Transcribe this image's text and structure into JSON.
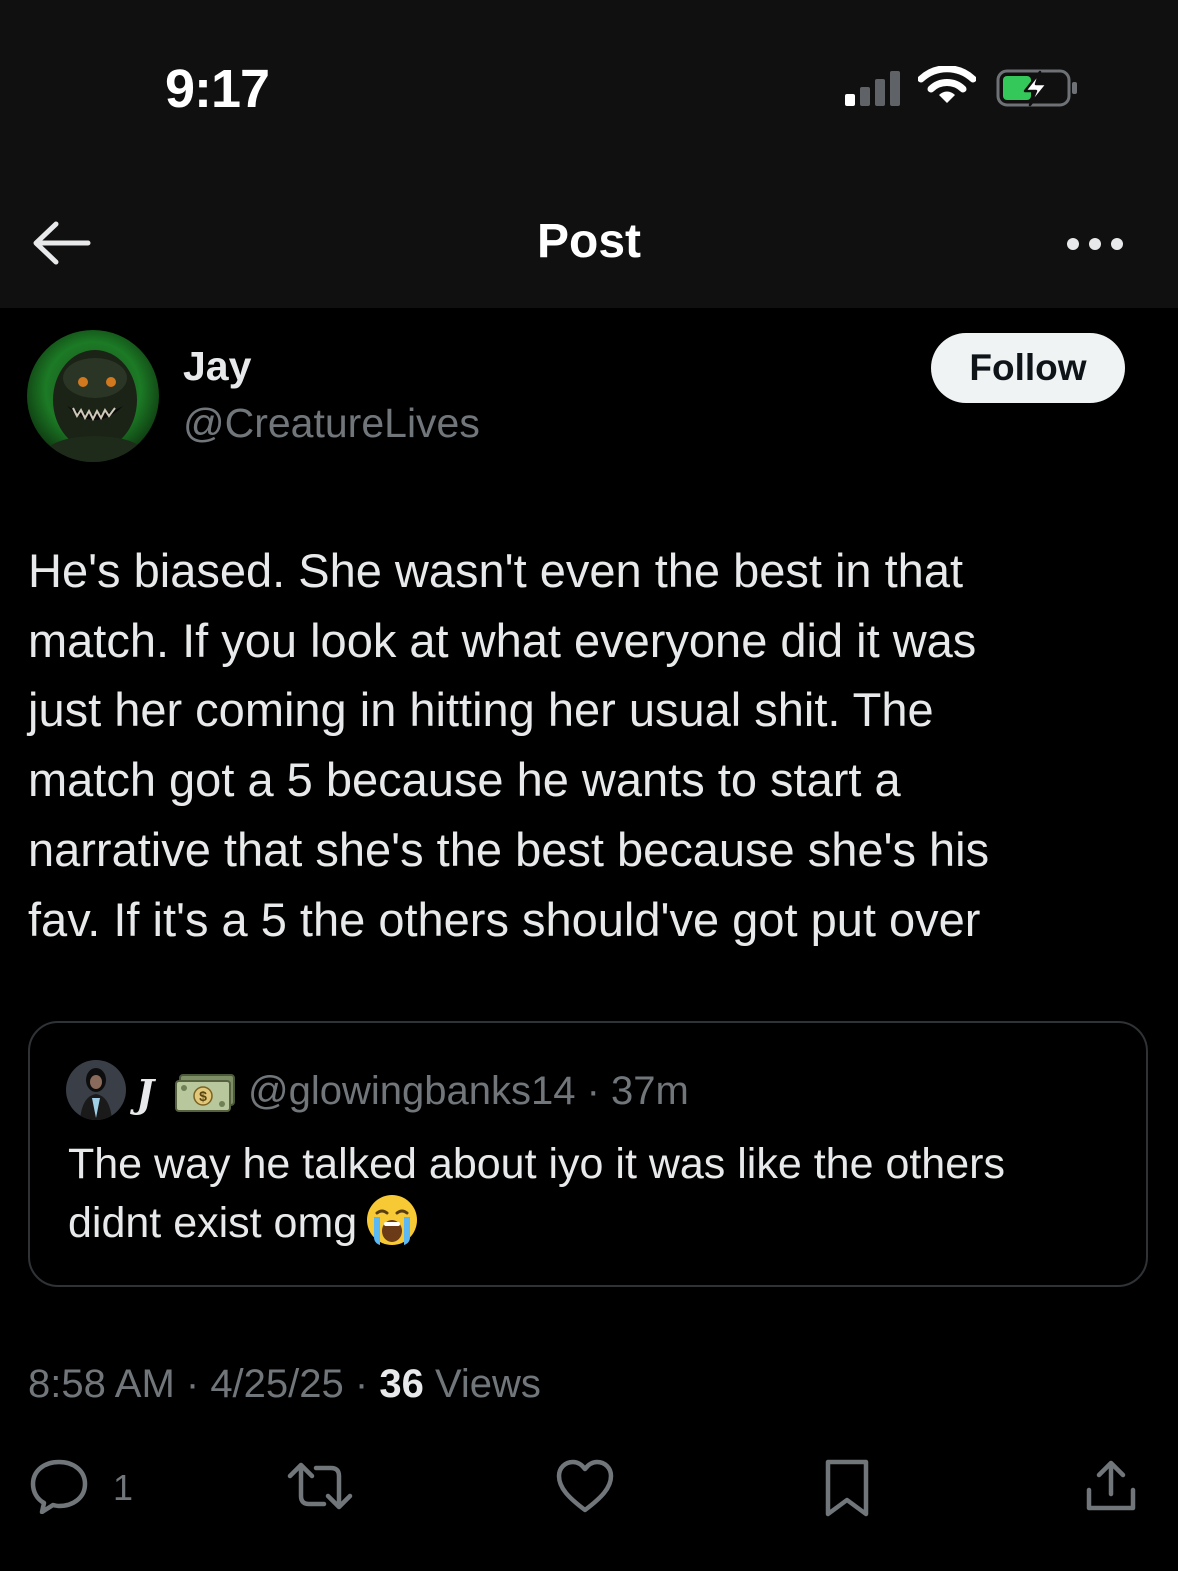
{
  "status_bar": {
    "time": "9:17"
  },
  "nav": {
    "title": "Post"
  },
  "post": {
    "author_name": "Jay",
    "author_handle": "@CreatureLives",
    "follow_label": "Follow",
    "text": "He's biased. She wasn't even the best in that\nmatch. If you look at what everyone did it was\njust her coming in hitting her usual shit. The\nmatch got a 5 because he wants to start a\nnarrative that she's the best because she's his\nfav. If it's a 5 the others should've got put over",
    "time": "8:58 AM",
    "date": "4/25/25",
    "views_count": "36",
    "views_label": "Views",
    "separator": " · "
  },
  "quote": {
    "author_name": "J",
    "author_handle": "@glowingbanks14",
    "age": "37m",
    "text": "The way he talked about iyo it was like the others\ndidnt exist omg"
  },
  "actions": {
    "reply_count": "1"
  },
  "icons": {
    "back": "arrow-left-icon",
    "more": "more-dots-icon",
    "reply": "speech-bubble-icon",
    "repost": "repost-icon",
    "like": "heart-icon",
    "bookmark": "bookmark-icon",
    "share": "share-icon",
    "emoji": "loudly-crying-face-emoji",
    "badge": "money-bill-emoji"
  },
  "colors": {
    "background": "#000000",
    "bar_background": "#101010",
    "text_primary": "#e7e9ea",
    "text_secondary": "#71767b",
    "border": "#2f3336",
    "follow_bg": "#eff3f4",
    "battery_green": "#34c759"
  }
}
